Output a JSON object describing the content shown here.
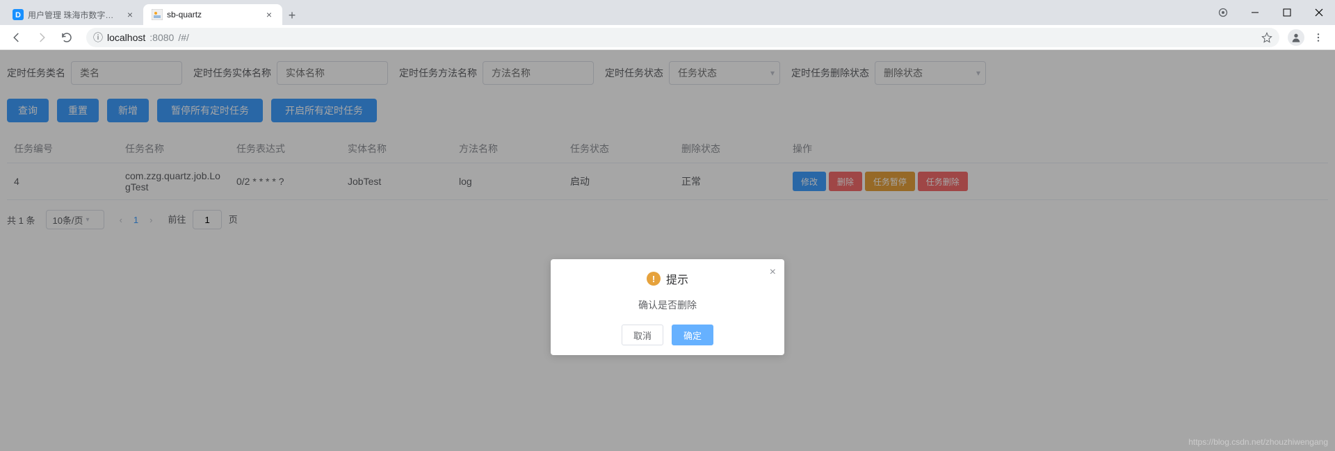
{
  "browser": {
    "tabs": [
      {
        "title": "用户管理 珠海市数字城建档案管",
        "active": false
      },
      {
        "title": "sb-quartz",
        "active": true
      }
    ],
    "url_host": "localhost",
    "url_port": ":8080",
    "url_path": "/#/"
  },
  "filters": {
    "class_label": "定时任务类名",
    "class_placeholder": "类名",
    "entity_label": "定时任务实体名称",
    "entity_placeholder": "实体名称",
    "method_label": "定时任务方法名称",
    "method_placeholder": "方法名称",
    "status_label": "定时任务状态",
    "status_placeholder": "任务状态",
    "delete_status_label": "定时任务删除状态",
    "delete_status_placeholder": "删除状态"
  },
  "action_buttons": {
    "query": "查询",
    "reset": "重置",
    "add": "新增",
    "pause_all": "暂停所有定时任务",
    "start_all": "开启所有定时任务"
  },
  "table": {
    "columns": {
      "id": "任务编号",
      "name": "任务名称",
      "expr": "任务表达式",
      "entity": "实体名称",
      "method": "方法名称",
      "status": "任务状态",
      "del_status": "删除状态",
      "ops": "操作"
    },
    "rows": [
      {
        "id": "4",
        "name": "com.zzg.quartz.job.LogTest",
        "expr": "0/2 * * * * ?",
        "entity": "JobTest",
        "method": "log",
        "status": "启动",
        "del_status": "正常"
      }
    ],
    "row_ops": {
      "edit": "修改",
      "delete": "删除",
      "pause": "任务暂停",
      "task_delete": "任务删除"
    }
  },
  "pagination": {
    "total_label": "共 1 条",
    "page_size": "10条/页",
    "current": "1",
    "jump_prefix": "前往",
    "jump_value": "1",
    "jump_suffix": "页"
  },
  "modal": {
    "title": "提示",
    "message": "确认是否删除",
    "cancel": "取消",
    "confirm": "确定"
  },
  "watermark": "https://blog.csdn.net/zhouzhiwengang"
}
